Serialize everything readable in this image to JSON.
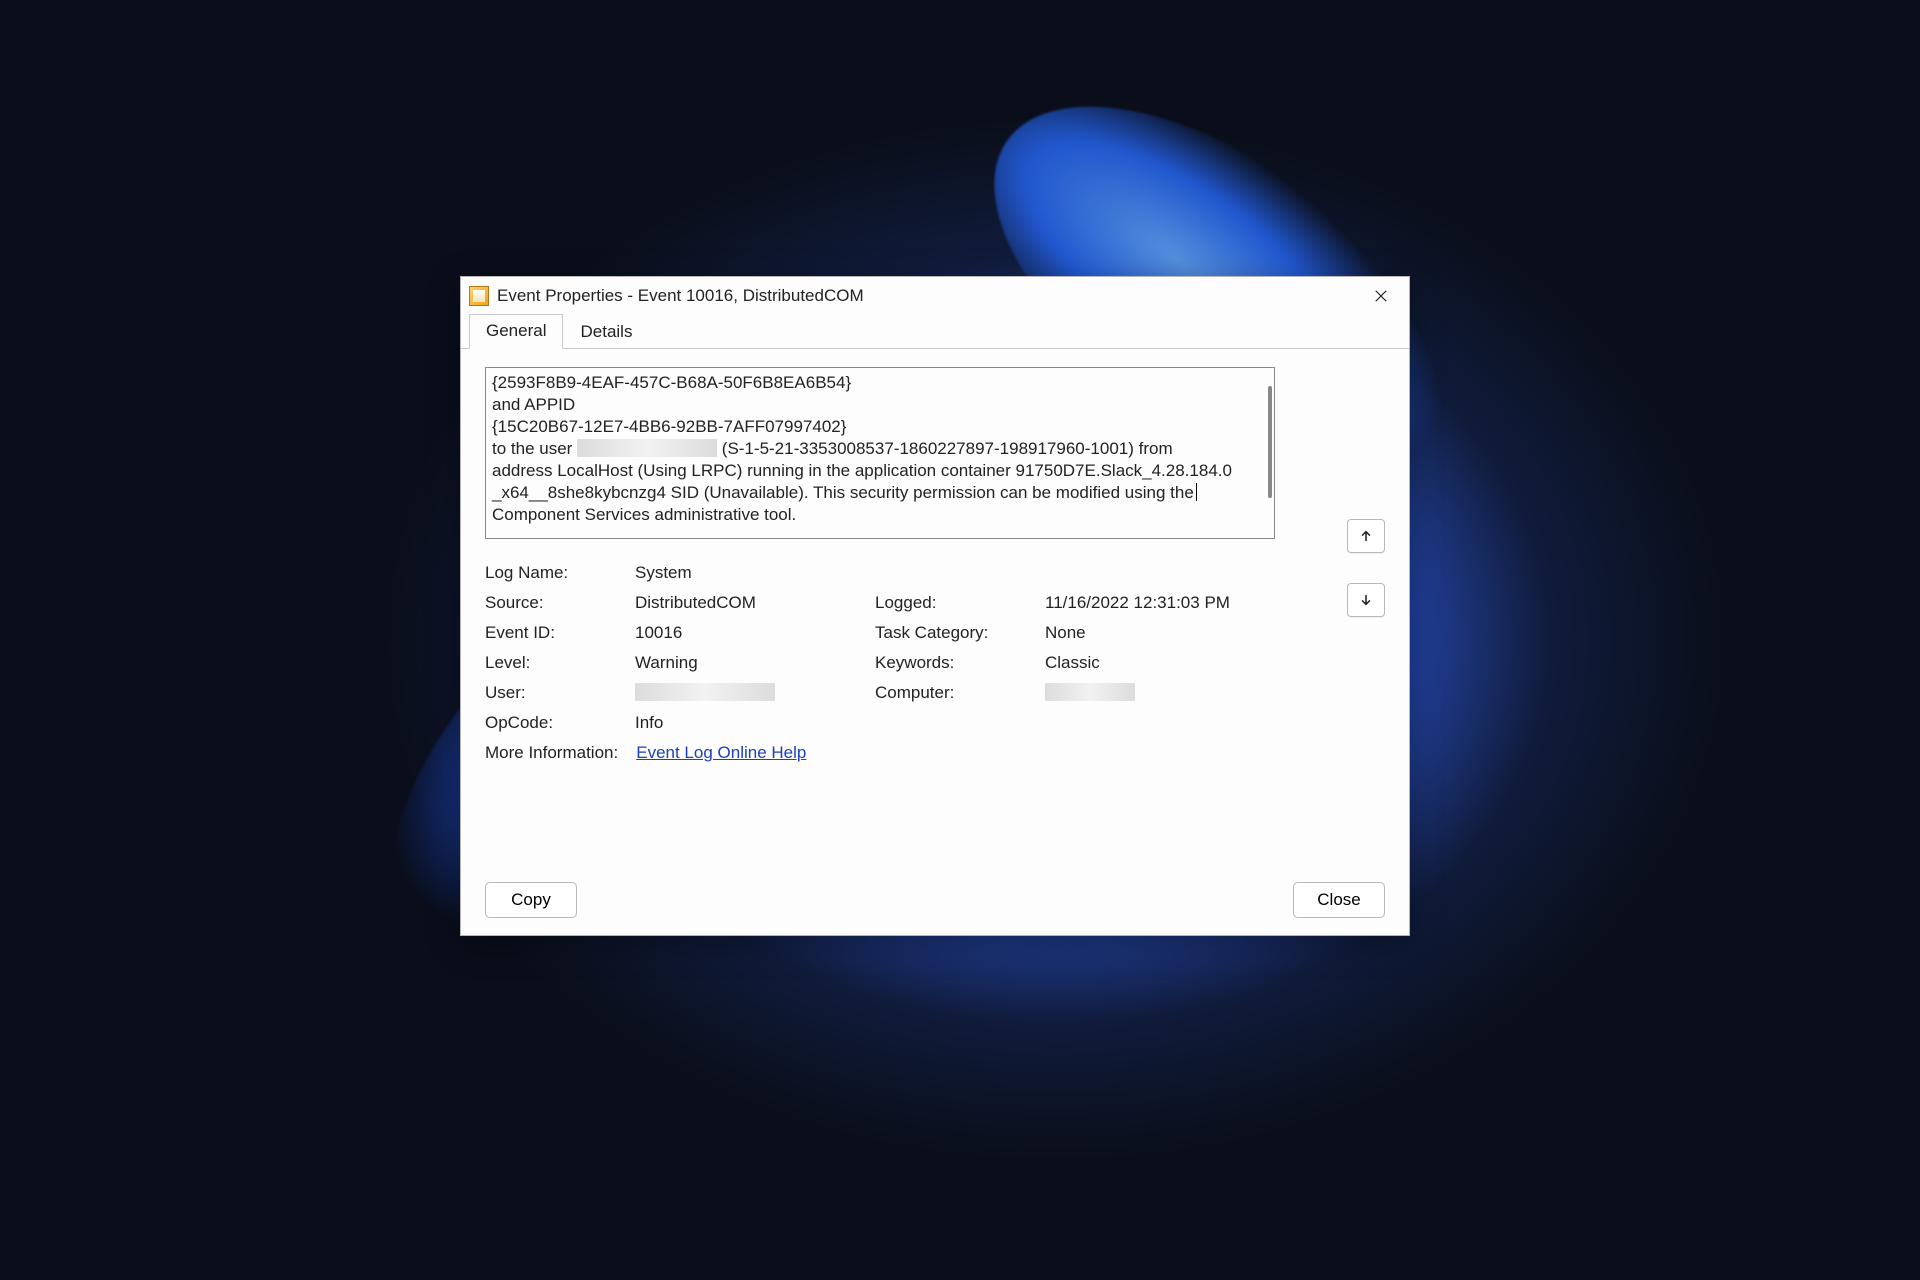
{
  "window": {
    "title": "Event Properties - Event 10016, DistributedCOM"
  },
  "tabs": {
    "general": "General",
    "details": "Details"
  },
  "description": {
    "line1": "{2593F8B9-4EAF-457C-B68A-50F6B8EA6B54}",
    "line2": " and APPID",
    "line3": "{15C20B67-12E7-4BB6-92BB-7AFF07997402}",
    "line4_prefix": " to the user ",
    "line4_suffix": " (S-1-5-21-3353008537-1860227897-198917960-1001) from",
    "line5": "address LocalHost (Using LRPC) running in the application container 91750D7E.Slack_4.28.184.0",
    "line6": "_x64__8she8kybcnzg4 SID (Unavailable). This security permission can be modified using the",
    "line7": "Component Services administrative tool."
  },
  "fields": {
    "log_name_label": "Log Name:",
    "log_name_value": "System",
    "source_label": "Source:",
    "source_value": "DistributedCOM",
    "logged_label": "Logged:",
    "logged_value": "11/16/2022 12:31:03 PM",
    "event_id_label": "Event ID:",
    "event_id_value": "10016",
    "task_category_label": "Task Category:",
    "task_category_value": "None",
    "level_label": "Level:",
    "level_value": "Warning",
    "keywords_label": "Keywords:",
    "keywords_value": "Classic",
    "user_label": "User:",
    "computer_label": "Computer:",
    "opcode_label": "OpCode:",
    "opcode_value": "Info",
    "more_info_label": "More Information:",
    "more_info_link": "Event Log Online Help"
  },
  "buttons": {
    "copy": "Copy",
    "close": "Close"
  }
}
